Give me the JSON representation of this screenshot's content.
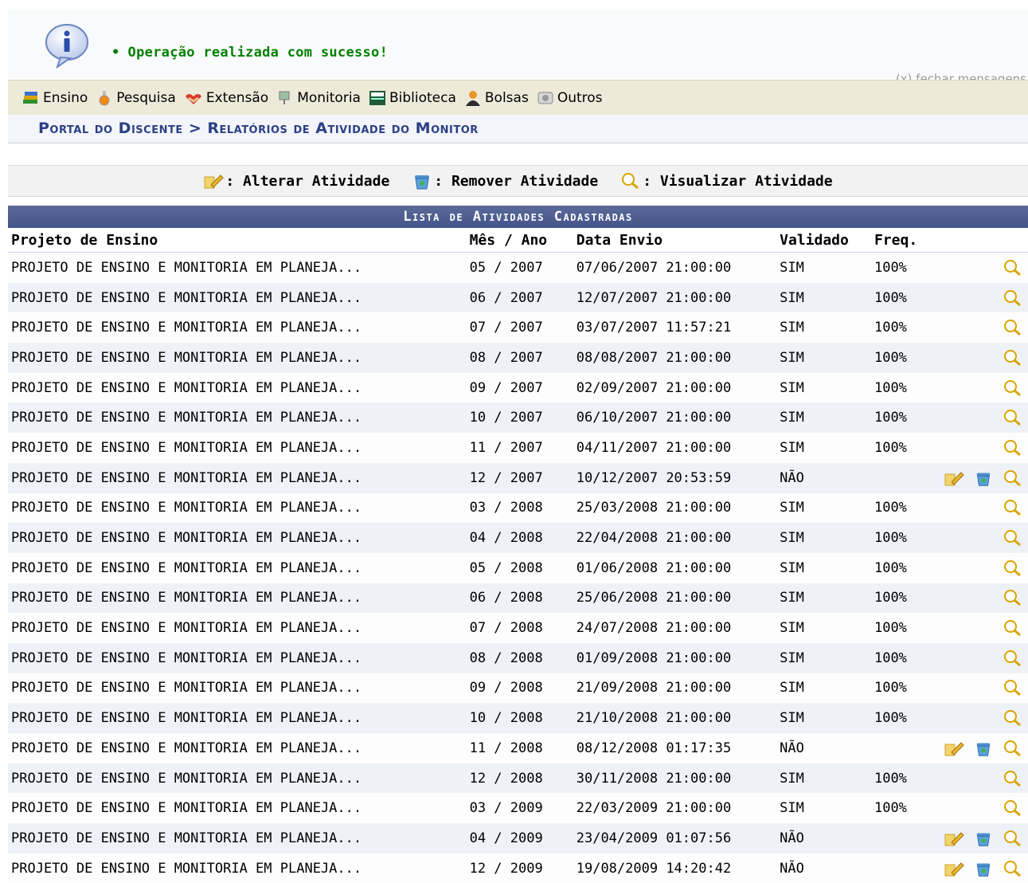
{
  "message": {
    "text": "Operação realizada com sucesso!",
    "bullet": "•",
    "close_label": "(x) fechar mensagens"
  },
  "menu": [
    {
      "label": "Ensino",
      "icon": "books-icon"
    },
    {
      "label": "Pesquisa",
      "icon": "flask-icon"
    },
    {
      "label": "Extensão",
      "icon": "hands-icon"
    },
    {
      "label": "Monitoria",
      "icon": "monitor-icon"
    },
    {
      "label": "Biblioteca",
      "icon": "library-icon"
    },
    {
      "label": "Bolsas",
      "icon": "person-icon"
    },
    {
      "label": "Outros",
      "icon": "gears-icon"
    }
  ],
  "breadcrumb": "Portal do Discente > Relatórios de Atividade do Monitor",
  "legend": {
    "alterar": ": Alterar Atividade",
    "remover": ": Remover Atividade",
    "visualizar": ": Visualizar Atividade"
  },
  "table": {
    "caption": "Lista de Atividades Cadastradas",
    "headers": {
      "projeto": "Projeto de Ensino",
      "mes_ano": "Mês / Ano",
      "data_envio": "Data Envio",
      "validado": "Validado",
      "freq": "Freq."
    },
    "rows": [
      {
        "projeto": "PROJETO DE ENSINO E MONITORIA EM PLANEJA...",
        "mes_ano": "05 / 2007",
        "data_envio": "07/06/2007 21:00:00",
        "validado": "SIM",
        "freq": "100%",
        "editable": false
      },
      {
        "projeto": "PROJETO DE ENSINO E MONITORIA EM PLANEJA...",
        "mes_ano": "06 / 2007",
        "data_envio": "12/07/2007 21:00:00",
        "validado": "SIM",
        "freq": "100%",
        "editable": false
      },
      {
        "projeto": "PROJETO DE ENSINO E MONITORIA EM PLANEJA...",
        "mes_ano": "07 / 2007",
        "data_envio": "03/07/2007 11:57:21",
        "validado": "SIM",
        "freq": "100%",
        "editable": false
      },
      {
        "projeto": "PROJETO DE ENSINO E MONITORIA EM PLANEJA...",
        "mes_ano": "08 / 2007",
        "data_envio": "08/08/2007 21:00:00",
        "validado": "SIM",
        "freq": "100%",
        "editable": false
      },
      {
        "projeto": "PROJETO DE ENSINO E MONITORIA EM PLANEJA...",
        "mes_ano": "09 / 2007",
        "data_envio": "02/09/2007 21:00:00",
        "validado": "SIM",
        "freq": "100%",
        "editable": false
      },
      {
        "projeto": "PROJETO DE ENSINO E MONITORIA EM PLANEJA...",
        "mes_ano": "10 / 2007",
        "data_envio": "06/10/2007 21:00:00",
        "validado": "SIM",
        "freq": "100%",
        "editable": false
      },
      {
        "projeto": "PROJETO DE ENSINO E MONITORIA EM PLANEJA...",
        "mes_ano": "11 / 2007",
        "data_envio": "04/11/2007 21:00:00",
        "validado": "SIM",
        "freq": "100%",
        "editable": false
      },
      {
        "projeto": "PROJETO DE ENSINO E MONITORIA EM PLANEJA...",
        "mes_ano": "12 / 2007",
        "data_envio": "10/12/2007 20:53:59",
        "validado": "NÃO",
        "freq": "",
        "editable": true
      },
      {
        "projeto": "PROJETO DE ENSINO E MONITORIA EM PLANEJA...",
        "mes_ano": "03 / 2008",
        "data_envio": "25/03/2008 21:00:00",
        "validado": "SIM",
        "freq": "100%",
        "editable": false
      },
      {
        "projeto": "PROJETO DE ENSINO E MONITORIA EM PLANEJA...",
        "mes_ano": "04 / 2008",
        "data_envio": "22/04/2008 21:00:00",
        "validado": "SIM",
        "freq": "100%",
        "editable": false
      },
      {
        "projeto": "PROJETO DE ENSINO E MONITORIA EM PLANEJA...",
        "mes_ano": "05 / 2008",
        "data_envio": "01/06/2008 21:00:00",
        "validado": "SIM",
        "freq": "100%",
        "editable": false
      },
      {
        "projeto": "PROJETO DE ENSINO E MONITORIA EM PLANEJA...",
        "mes_ano": "06 / 2008",
        "data_envio": "25/06/2008 21:00:00",
        "validado": "SIM",
        "freq": "100%",
        "editable": false
      },
      {
        "projeto": "PROJETO DE ENSINO E MONITORIA EM PLANEJA...",
        "mes_ano": "07 / 2008",
        "data_envio": "24/07/2008 21:00:00",
        "validado": "SIM",
        "freq": "100%",
        "editable": false
      },
      {
        "projeto": "PROJETO DE ENSINO E MONITORIA EM PLANEJA...",
        "mes_ano": "08 / 2008",
        "data_envio": "01/09/2008 21:00:00",
        "validado": "SIM",
        "freq": "100%",
        "editable": false
      },
      {
        "projeto": "PROJETO DE ENSINO E MONITORIA EM PLANEJA...",
        "mes_ano": "09 / 2008",
        "data_envio": "21/09/2008 21:00:00",
        "validado": "SIM",
        "freq": "100%",
        "editable": false
      },
      {
        "projeto": "PROJETO DE ENSINO E MONITORIA EM PLANEJA...",
        "mes_ano": "10 / 2008",
        "data_envio": "21/10/2008 21:00:00",
        "validado": "SIM",
        "freq": "100%",
        "editable": false
      },
      {
        "projeto": "PROJETO DE ENSINO E MONITORIA EM PLANEJA...",
        "mes_ano": "11 / 2008",
        "data_envio": "08/12/2008 01:17:35",
        "validado": "NÃO",
        "freq": "",
        "editable": true
      },
      {
        "projeto": "PROJETO DE ENSINO E MONITORIA EM PLANEJA...",
        "mes_ano": "12 / 2008",
        "data_envio": "30/11/2008 21:00:00",
        "validado": "SIM",
        "freq": "100%",
        "editable": false
      },
      {
        "projeto": "PROJETO DE ENSINO E MONITORIA EM PLANEJA...",
        "mes_ano": "03 / 2009",
        "data_envio": "22/03/2009 21:00:00",
        "validado": "SIM",
        "freq": "100%",
        "editable": false
      },
      {
        "projeto": "PROJETO DE ENSINO E MONITORIA EM PLANEJA...",
        "mes_ano": "04 / 2009",
        "data_envio": "23/04/2009 01:07:56",
        "validado": "NÃO",
        "freq": "",
        "editable": true
      },
      {
        "projeto": "PROJETO DE ENSINO E MONITORIA EM PLANEJA...",
        "mes_ano": "12 / 2009",
        "data_envio": "19/08/2009 14:20:42",
        "validado": "NÃO",
        "freq": "",
        "editable": true
      }
    ]
  },
  "colors": {
    "success": "#008000",
    "breadcrumb": "#2b3f86",
    "caption_bg": "#4a5a8e",
    "row_alt": "#eef2f8"
  }
}
